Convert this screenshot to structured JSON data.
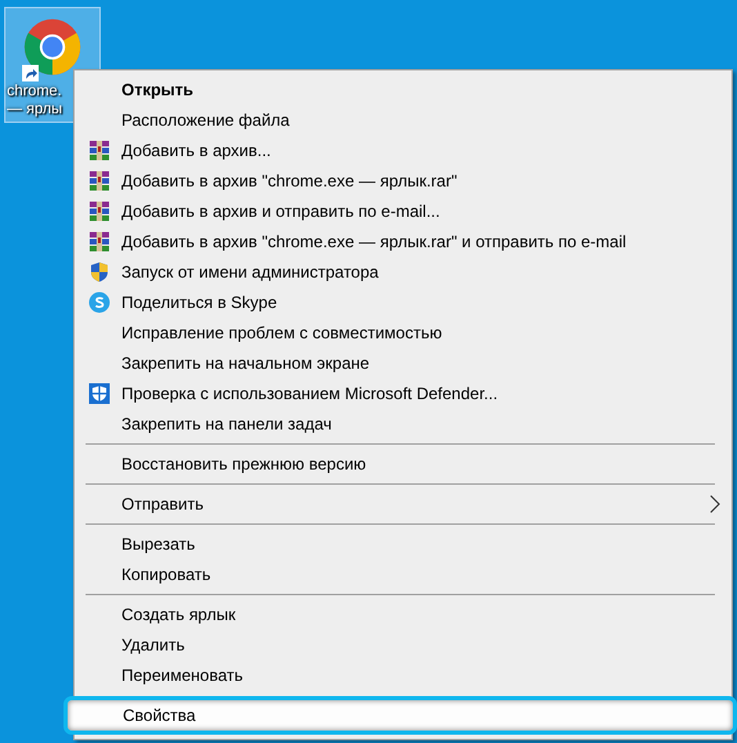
{
  "desktop_icon": {
    "label_lines": [
      "chrome.",
      "— ярлы"
    ],
    "selected": true
  },
  "context_menu": {
    "items": [
      {
        "kind": "default",
        "label": "Открыть",
        "selected": false
      },
      {
        "kind": "plain",
        "label": "Расположение файла",
        "selected": false
      },
      {
        "kind": "archive",
        "label": "Добавить в архив...",
        "selected": false
      },
      {
        "kind": "archive",
        "label": "Добавить в архив \"chrome.exe — ярлык.rar\"",
        "selected": false
      },
      {
        "kind": "archive",
        "label": "Добавить в архив и отправить по e-mail...",
        "selected": false
      },
      {
        "kind": "archive",
        "label": "Добавить в архив \"chrome.exe — ярлык.rar\" и отправить по e-mail",
        "selected": false
      },
      {
        "kind": "admin",
        "label": "Запуск от имени администратора",
        "selected": false
      },
      {
        "kind": "share",
        "label": "Поделиться в Skype",
        "selected": false
      },
      {
        "kind": "plain",
        "label": "Исправление проблем с совместимостью",
        "selected": false
      },
      {
        "kind": "plain",
        "label": "Закрепить на начальном экране",
        "selected": false
      },
      {
        "kind": "scan",
        "label": "Проверка с использованием Microsoft Defender...",
        "selected": false
      },
      {
        "kind": "plain",
        "label": "Закрепить на панели задач",
        "selected": false
      },
      {
        "kind": "separator"
      },
      {
        "kind": "plain",
        "label": "Восстановить прежнюю версию",
        "selected": false
      },
      {
        "kind": "separator"
      },
      {
        "kind": "submenu",
        "label": "Отправить",
        "selected": false
      },
      {
        "kind": "separator"
      },
      {
        "kind": "plain",
        "label": "Вырезать",
        "selected": false
      },
      {
        "kind": "plain",
        "label": "Копировать",
        "selected": false
      },
      {
        "kind": "separator"
      },
      {
        "kind": "plain",
        "label": "Создать ярлык",
        "selected": false
      },
      {
        "kind": "plain",
        "label": "Удалить",
        "selected": false
      },
      {
        "kind": "plain",
        "label": "Переименовать",
        "selected": false
      },
      {
        "kind": "plain",
        "label": "Свойства",
        "selected": true
      }
    ]
  }
}
